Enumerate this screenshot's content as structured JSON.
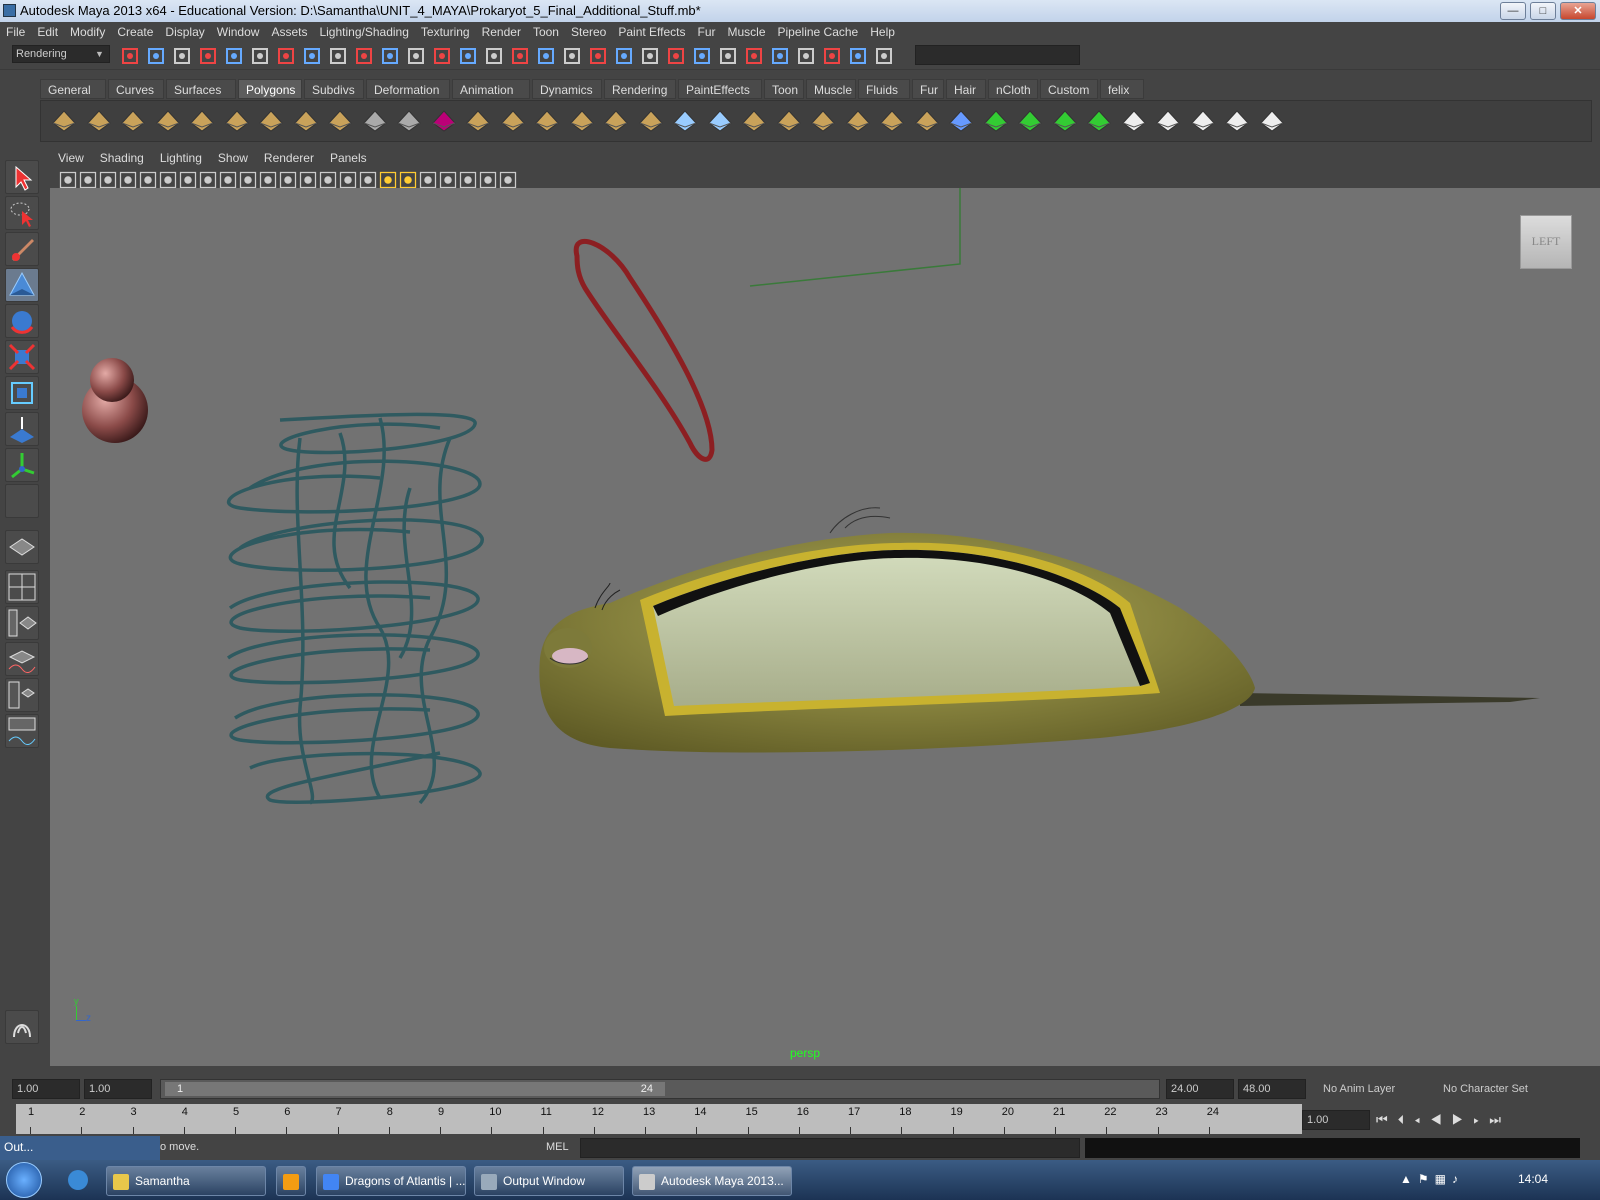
{
  "window": {
    "title": "Autodesk Maya 2013 x64 - Educational Version: D:\\Samantha\\UNIT_4_MAYA\\Prokaryot_5_Final_Additional_Stuff.mb*",
    "min": "—",
    "max": "□",
    "close": "✕"
  },
  "menubar": [
    "File",
    "Edit",
    "Modify",
    "Create",
    "Display",
    "Window",
    "Assets",
    "Lighting/Shading",
    "Texturing",
    "Render",
    "Toon",
    "Stereo",
    "Paint Effects",
    "Fur",
    "Muscle",
    "Pipeline Cache",
    "Help"
  ],
  "statusline": {
    "menuset": "Rendering"
  },
  "shelf": {
    "tabs": [
      "General",
      "Curves",
      "Surfaces",
      "Polygons",
      "Subdivs",
      "Deformation",
      "Animation",
      "Dynamics",
      "Rendering",
      "PaintEffects",
      "Toon",
      "Muscle",
      "Fluids",
      "Fur",
      "Hair",
      "nCloth",
      "Custom",
      "felix"
    ],
    "active": "Polygons"
  },
  "panel": {
    "menus": [
      "View",
      "Shading",
      "Lighting",
      "Show",
      "Renderer",
      "Panels"
    ],
    "camera": "persp",
    "viewcube": "LEFT",
    "axis_y": "y",
    "axis_z": "z"
  },
  "range": {
    "start_time": "1.00",
    "start_range": "1.00",
    "slider_start": "1",
    "slider_end": "24",
    "end_range": "24.00",
    "end_time": "48.00",
    "anim_layer": "No Anim Layer",
    "char_set": "No Character Set"
  },
  "timeline": {
    "frames": [
      "1",
      "2",
      "3",
      "4",
      "5",
      "6",
      "7",
      "8",
      "9",
      "10",
      "11",
      "12",
      "13",
      "14",
      "15",
      "16",
      "17",
      "18",
      "19",
      "20",
      "21",
      "22",
      "23",
      "24"
    ],
    "current_frame": "1.00"
  },
  "commandline": {
    "help_text": "o move.",
    "mel_label": "MEL",
    "output_window_label": "Out..."
  },
  "taskbar": {
    "items": [
      {
        "label": "Samantha"
      },
      {
        "label": ""
      },
      {
        "label": "Dragons of Atlantis | ..."
      },
      {
        "label": "Output Window"
      },
      {
        "label": "Autodesk Maya 2013..."
      }
    ],
    "clock": "14:04"
  }
}
